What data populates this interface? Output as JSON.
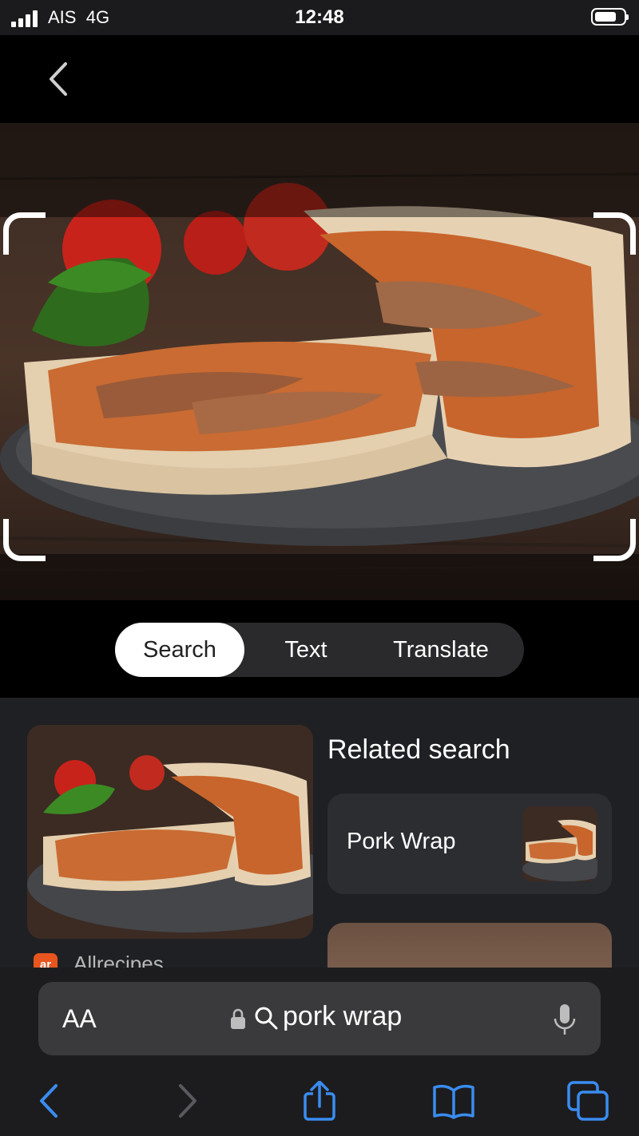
{
  "status": {
    "carrier": "AIS",
    "network": "4G",
    "time": "12:48"
  },
  "modes": {
    "search": "Search",
    "text": "Text",
    "translate": "Translate",
    "active": "Search"
  },
  "result": {
    "source": "Allrecipes"
  },
  "related": {
    "title": "Related search",
    "items": [
      {
        "label": "Pork Wrap"
      }
    ]
  },
  "browser": {
    "text_size_label": "AA",
    "url": "pork wrap"
  },
  "icons": {
    "back": "chevron-left-icon",
    "search": "search-icon",
    "lock": "lock-icon",
    "mic": "microphone-icon",
    "share": "share-icon",
    "bookmarks": "book-icon",
    "tabs": "tabs-icon"
  },
  "colors": {
    "accent": "#3a8cf0",
    "active_segment": "#ffffff",
    "result_bg": "#1f2023"
  }
}
